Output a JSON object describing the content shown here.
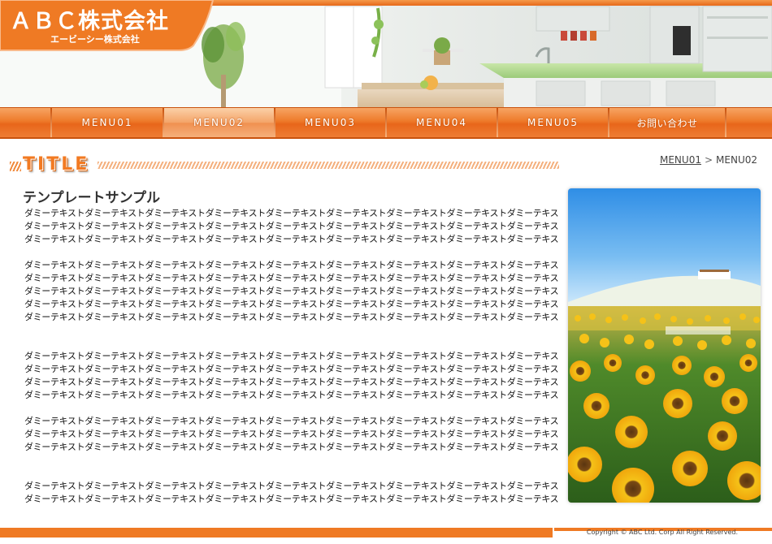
{
  "header": {
    "company_name": "ＡＢＣ株式会社",
    "company_kana": "エービーシー株式会社"
  },
  "nav": {
    "items": [
      {
        "label": "MENU01"
      },
      {
        "label": "MENU02"
      },
      {
        "label": "MENU03"
      },
      {
        "label": "MENU04"
      },
      {
        "label": "MENU05"
      },
      {
        "label": "お問い合わせ"
      }
    ],
    "active_index": 1
  },
  "page": {
    "title": "TITLE",
    "heading": "テンプレートサンプル"
  },
  "breadcrumb": {
    "parent": "MENU01",
    "separator": ">",
    "current": "MENU02"
  },
  "content": {
    "paragraphs": [
      [
        "ダミーテキストダミーテキストダミーテキストダミーテキストダミーテキストダミーテキストダミーテキストダミーテキストダミーテキスト",
        "ダミーテキストダミーテキストダミーテキストダミーテキストダミーテキストダミーテキストダミーテキストダミーテキストダミーテキスト",
        "ダミーテキストダミーテキストダミーテキストダミーテキストダミーテキストダミーテキストダミーテキストダミーテキストダミーテキスト"
      ],
      [
        "ダミーテキストダミーテキストダミーテキストダミーテキストダミーテキストダミーテキストダミーテキストダミーテキストダミーテキスト",
        "ダミーテキストダミーテキストダミーテキストダミーテキストダミーテキストダミーテキストダミーテキストダミーテキストダミーテキスト",
        "ダミーテキストダミーテキストダミーテキストダミーテキストダミーテキストダミーテキストダミーテキストダミーテキストダミーテキスト",
        "ダミーテキストダミーテキストダミーテキストダミーテキストダミーテキストダミーテキストダミーテキストダミーテキストダミーテキスト",
        "ダミーテキストダミーテキストダミーテキストダミーテキストダミーテキストダミーテキストダミーテキストダミーテキストダミーテキスト"
      ],
      [
        "ダミーテキストダミーテキストダミーテキストダミーテキストダミーテキストダミーテキストダミーテキストダミーテキストダミーテキスト",
        "ダミーテキストダミーテキストダミーテキストダミーテキストダミーテキストダミーテキストダミーテキストダミーテキストダミーテキスト",
        "ダミーテキストダミーテキストダミーテキストダミーテキストダミーテキストダミーテキストダミーテキストダミーテキストダミーテキスト",
        "ダミーテキストダミーテキストダミーテキストダミーテキストダミーテキストダミーテキストダミーテキストダミーテキストダミーテキスト"
      ],
      [
        "ダミーテキストダミーテキストダミーテキストダミーテキストダミーテキストダミーテキストダミーテキストダミーテキストダミーテキスト",
        "ダミーテキストダミーテキストダミーテキストダミーテキストダミーテキストダミーテキストダミーテキストダミーテキストダミーテキスト",
        "ダミーテキストダミーテキストダミーテキストダミーテキストダミーテキストダミーテキストダミーテキストダミーテキストダミーテキスト"
      ],
      [
        "ダミーテキストダミーテキストダミーテキストダミーテキストダミーテキストダミーテキストダミーテキストダミーテキストダミーテキスト",
        "ダミーテキストダミーテキストダミーテキストダミーテキストダミーテキストダミーテキストダミーテキストダミーテキストダミーテキスト"
      ]
    ]
  },
  "footer": {
    "copyright": "Copyright © ABC Ltd. Corp All Right Reserved."
  },
  "colors": {
    "accent": "#ef7a24",
    "accent_dark": "#c9520d",
    "accent_light": "#f7a463"
  }
}
